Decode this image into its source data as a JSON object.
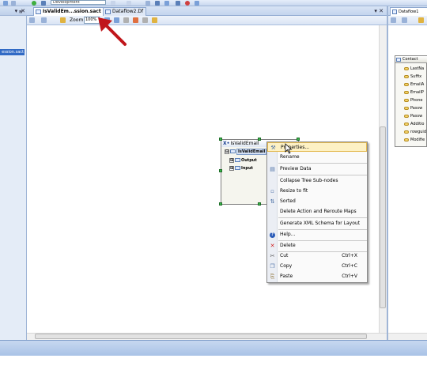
{
  "topbar": {
    "config_value": "Development"
  },
  "left_panel": {
    "header_text": "▾ ྸ ✕",
    "selected_item": "ession.sact"
  },
  "tabs": {
    "active": "IsValidEm...ssion.sact",
    "inactive": "Dataflow2.Df",
    "close_area": "▾ ✕"
  },
  "doc_toolbar": {
    "zoom_label": "Zoom",
    "zoom_value": "100%"
  },
  "node": {
    "title": "IsValidEmail",
    "x_mark": "X•",
    "tree_root": "IsValidEmail",
    "tree_output": "Output",
    "tree_input": "Input",
    "expand_glyph": "⊞",
    "collapse_glyph": "⊟"
  },
  "context_menu": {
    "items": [
      {
        "label": "Properties...",
        "icon": "wrench-icon",
        "glyph": "⚒"
      },
      {
        "label": "Rename",
        "icon": "",
        "glyph": ""
      },
      {
        "label": "Preview Data",
        "icon": "preview-data-icon",
        "glyph": "▤"
      },
      {
        "label": "Collapse Tree Sub-nodes",
        "icon": "",
        "glyph": ""
      },
      {
        "label": "Resize to fit",
        "icon": "resize-icon",
        "glyph": "▫"
      },
      {
        "label": "Sorted",
        "icon": "sort-icon",
        "glyph": "⇅"
      },
      {
        "label": "Delete Action and Reroute Maps",
        "icon": "",
        "glyph": ""
      },
      {
        "label": "Generate XML Schema for Layout",
        "icon": "",
        "glyph": ""
      },
      {
        "label": "Help...",
        "icon": "help-icon",
        "glyph": "?"
      },
      {
        "label": "Delete",
        "icon": "delete-icon",
        "glyph": "✕"
      },
      {
        "label": "Cut",
        "shortcut": "Ctrl+X",
        "icon": "cut-icon",
        "glyph": "✂"
      },
      {
        "label": "Copy",
        "shortcut": "Ctrl+C",
        "icon": "copy-icon",
        "glyph": "❐"
      },
      {
        "label": "Paste",
        "shortcut": "Ctrl+V",
        "icon": "paste-icon",
        "glyph": "⎘"
      }
    ]
  },
  "right_panel": {
    "tab": "Dataflow1",
    "entity_title": "Contact",
    "fields": [
      "LastNa",
      "Suffix",
      "EmailA",
      "EmailP",
      "Phone",
      "Passw",
      "Passw",
      "Additio",
      "rowguid",
      "Modifie"
    ]
  },
  "colors": {
    "selection_blue": "#316ac5",
    "menu_hover": "#fdf1c4",
    "node_handle_green": "#39b54a",
    "annotation_red": "#c0161b"
  }
}
